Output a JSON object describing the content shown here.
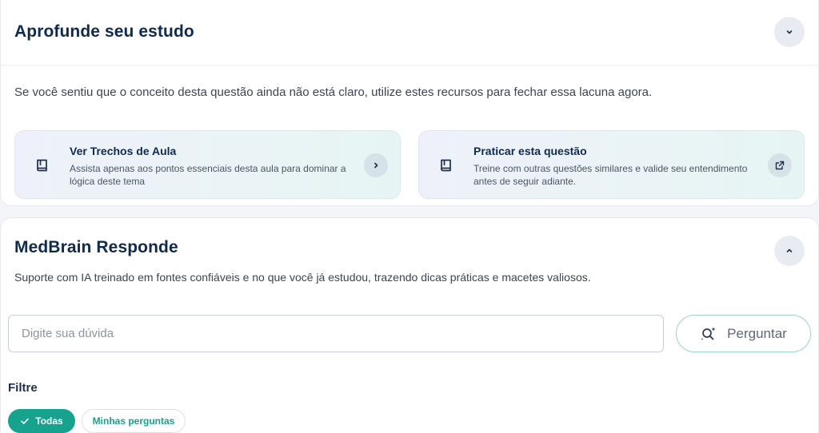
{
  "study": {
    "title": "Aprofunde seu estudo",
    "toggle_icon": "chevron-down-icon",
    "description": "Se você sentiu que o conceito desta questão ainda não está claro, utilize estes recursos para fechar essa lacuna agora.",
    "resources": [
      {
        "title": "Ver Trechos de Aula",
        "description": "Assista apenas aos pontos essenciais desta aula para dominar a lógica deste tema",
        "icon": "book-icon",
        "action_icon": "chevron-right-icon"
      },
      {
        "title": "Praticar esta questão",
        "description": "Treine com outras questões similares e valide seu entendimento antes de seguir adiante.",
        "icon": "book-icon",
        "action_icon": "external-link-icon"
      }
    ]
  },
  "medbrain": {
    "title": "MedBrain Responde",
    "toggle_icon": "chevron-up-icon",
    "description": "Suporte com IA treinado em fontes confiáveis e no que você já estudou, trazendo dicas práticas e macetes valiosos.",
    "input": {
      "placeholder": "Digite sua dúvida",
      "value": ""
    },
    "ask_button": {
      "label": "Perguntar",
      "icon": "ai-search-icon"
    },
    "filter": {
      "label": "Filtre",
      "options": [
        {
          "label": "Todas",
          "selected": true
        },
        {
          "label": "Minhas perguntas",
          "selected": false
        }
      ]
    }
  },
  "colors": {
    "primary": "#16a28d",
    "heading": "#0f2a4f",
    "text": "#3b4454"
  }
}
